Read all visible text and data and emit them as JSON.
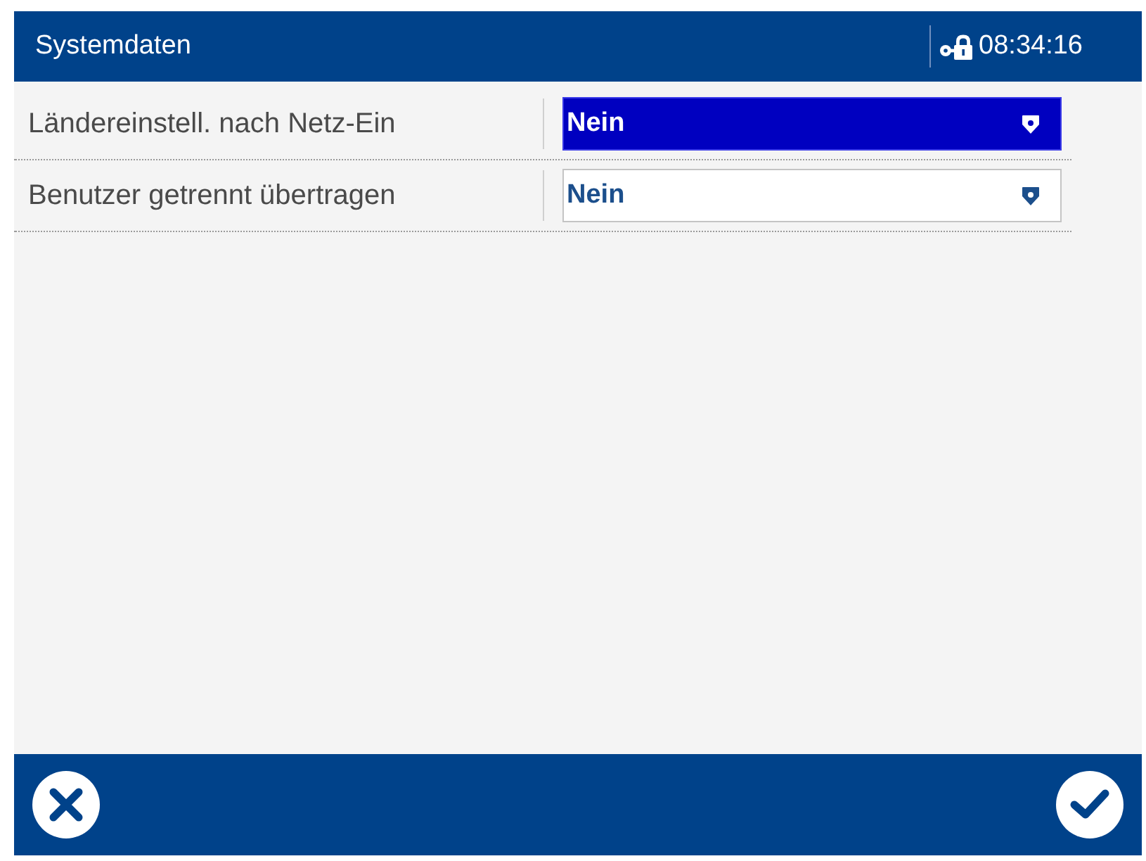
{
  "header": {
    "title": "Systemdaten",
    "time": "08:34:16"
  },
  "settings": [
    {
      "label": "Ländereinstell. nach Netz-Ein",
      "value": "Nein",
      "selected": true
    },
    {
      "label": "Benutzer getrennt übertragen",
      "value": "Nein",
      "selected": false
    }
  ],
  "footer": {
    "buttons": [
      {
        "kind": "cancel"
      },
      {
        "kind": "confirm"
      }
    ]
  }
}
